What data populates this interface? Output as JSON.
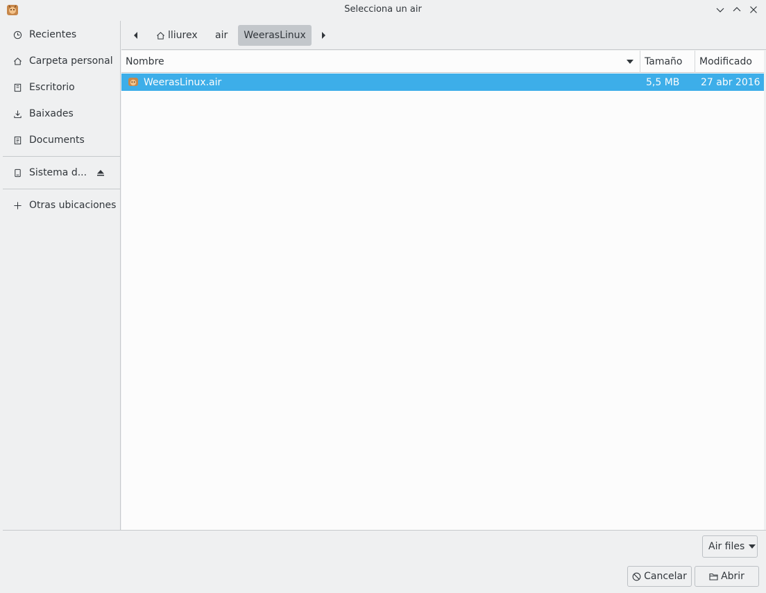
{
  "window": {
    "title": "Selecciona un air",
    "app_icon": "air-app-icon",
    "controls": [
      "minimize-icon",
      "maximize-icon",
      "close-icon"
    ]
  },
  "sidebar": {
    "items": [
      {
        "label": "Recientes",
        "icon": "clock-icon"
      },
      {
        "label": "Carpeta personal",
        "icon": "home-icon"
      },
      {
        "label": "Escritorio",
        "icon": "desktop-icon"
      },
      {
        "label": "Baixades",
        "icon": "download-icon"
      },
      {
        "label": "Documents",
        "icon": "documents-icon"
      }
    ],
    "devices": [
      {
        "label": "Sistema d...",
        "icon": "drive-icon",
        "eject": "eject-icon"
      }
    ],
    "other": {
      "label": "Otras ubicaciones",
      "icon": "plus-icon"
    }
  },
  "pathbar": {
    "segments": [
      "lliurex",
      "air",
      "WeerasLinux"
    ],
    "active": "WeerasLinux"
  },
  "filelist": {
    "columns": [
      "Nombre",
      "Tamaño",
      "Modificado"
    ],
    "sort_column": "Nombre",
    "rows": [
      {
        "name": "WeerasLinux.air",
        "size": "5,5 MB",
        "modified": "27 abr 2016",
        "selected": true
      }
    ]
  },
  "footer": {
    "filter_label": "Air files",
    "cancel_label": "Cancelar",
    "open_label": "Abrir"
  },
  "colors": {
    "selection": "#3daee9",
    "window_bg": "#eff0f1",
    "view_bg": "#fcfcfc",
    "text": "#31363b"
  }
}
